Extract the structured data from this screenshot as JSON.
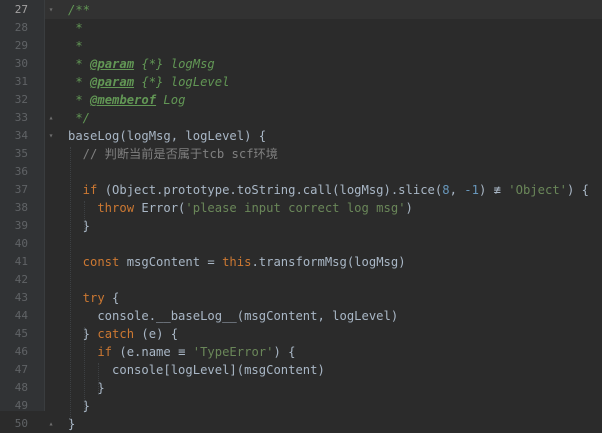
{
  "editor": {
    "theme_colors": {
      "background": "#2b2b2b",
      "gutter": "#313335",
      "keyword": "#cc7832",
      "string": "#6a8759",
      "number": "#6897bb",
      "doc_comment": "#629755",
      "line_comment": "#808080",
      "identifier": "#a9b7c6"
    },
    "current_line": "27",
    "lines": [
      {
        "n": "27",
        "tokens": [
          {
            "c": "t-doc",
            "t": "/**"
          }
        ]
      },
      {
        "n": "28",
        "tokens": [
          {
            "c": "t-doc",
            "t": " *"
          }
        ]
      },
      {
        "n": "29",
        "tokens": [
          {
            "c": "t-doc",
            "t": " *"
          }
        ]
      },
      {
        "n": "30",
        "tokens": [
          {
            "c": "t-doc",
            "t": " * "
          },
          {
            "c": "t-tag",
            "t": "@param"
          },
          {
            "c": "t-type",
            "t": " {*} "
          },
          {
            "c": "t-doc",
            "t": "logMsg"
          }
        ]
      },
      {
        "n": "31",
        "tokens": [
          {
            "c": "t-doc",
            "t": " * "
          },
          {
            "c": "t-tag",
            "t": "@param"
          },
          {
            "c": "t-type",
            "t": " {*} "
          },
          {
            "c": "t-doc",
            "t": "logLevel"
          }
        ]
      },
      {
        "n": "32",
        "tokens": [
          {
            "c": "t-doc",
            "t": " * "
          },
          {
            "c": "t-tag",
            "t": "@memberof"
          },
          {
            "c": "t-doc",
            "t": " Log"
          }
        ]
      },
      {
        "n": "33",
        "tokens": [
          {
            "c": "t-doc",
            "t": " */"
          }
        ]
      },
      {
        "n": "34",
        "tokens": [
          {
            "c": "t-plain",
            "t": "baseLog(logMsg, logLevel) {"
          }
        ]
      },
      {
        "n": "35",
        "tokens": [
          {
            "c": "t-com",
            "t": "  // 判断当前是否属于tcb scf环境"
          }
        ]
      },
      {
        "n": "36",
        "tokens": []
      },
      {
        "n": "37",
        "tokens": [
          {
            "c": "t-kw",
            "t": "  if "
          },
          {
            "c": "t-plain",
            "t": "(Object.prototype.toString.call(logMsg).slice("
          },
          {
            "c": "t-num",
            "t": "8"
          },
          {
            "c": "t-plain",
            "t": ", "
          },
          {
            "c": "t-num",
            "t": "-1"
          },
          {
            "c": "t-plain",
            "t": ") ≢ "
          },
          {
            "c": "t-str",
            "t": "'Object'"
          },
          {
            "c": "t-plain",
            "t": ") {"
          }
        ]
      },
      {
        "n": "38",
        "tokens": [
          {
            "c": "t-kw",
            "t": "    throw "
          },
          {
            "c": "t-plain",
            "t": "Error("
          },
          {
            "c": "t-str",
            "t": "'please input correct log msg'"
          },
          {
            "c": "t-plain",
            "t": ")"
          }
        ]
      },
      {
        "n": "39",
        "tokens": [
          {
            "c": "t-plain",
            "t": "  }"
          }
        ]
      },
      {
        "n": "40",
        "tokens": []
      },
      {
        "n": "41",
        "tokens": [
          {
            "c": "t-kw",
            "t": "  const "
          },
          {
            "c": "t-plain",
            "t": "msgContent = "
          },
          {
            "c": "t-this",
            "t": "this"
          },
          {
            "c": "t-plain",
            "t": ".transformMsg(logMsg)"
          }
        ]
      },
      {
        "n": "42",
        "tokens": []
      },
      {
        "n": "43",
        "tokens": [
          {
            "c": "t-kw",
            "t": "  try "
          },
          {
            "c": "t-plain",
            "t": "{"
          }
        ]
      },
      {
        "n": "44",
        "tokens": [
          {
            "c": "t-plain",
            "t": "    console.__baseLog__(msgContent, logLevel)"
          }
        ]
      },
      {
        "n": "45",
        "tokens": [
          {
            "c": "t-plain",
            "t": "  } "
          },
          {
            "c": "t-kw",
            "t": "catch "
          },
          {
            "c": "t-plain",
            "t": "(e) {"
          }
        ]
      },
      {
        "n": "46",
        "tokens": [
          {
            "c": "t-kw",
            "t": "    if "
          },
          {
            "c": "t-plain",
            "t": "(e.name ≡ "
          },
          {
            "c": "t-str",
            "t": "'TypeError'"
          },
          {
            "c": "t-plain",
            "t": ") {"
          }
        ]
      },
      {
        "n": "47",
        "tokens": [
          {
            "c": "t-plain",
            "t": "      console[logLevel](msgContent)"
          }
        ]
      },
      {
        "n": "48",
        "tokens": [
          {
            "c": "t-plain",
            "t": "    }"
          }
        ]
      },
      {
        "n": "49",
        "tokens": [
          {
            "c": "t-plain",
            "t": "  }"
          }
        ]
      },
      {
        "n": "50",
        "tokens": [
          {
            "c": "t-plain",
            "t": "}"
          }
        ]
      }
    ]
  }
}
